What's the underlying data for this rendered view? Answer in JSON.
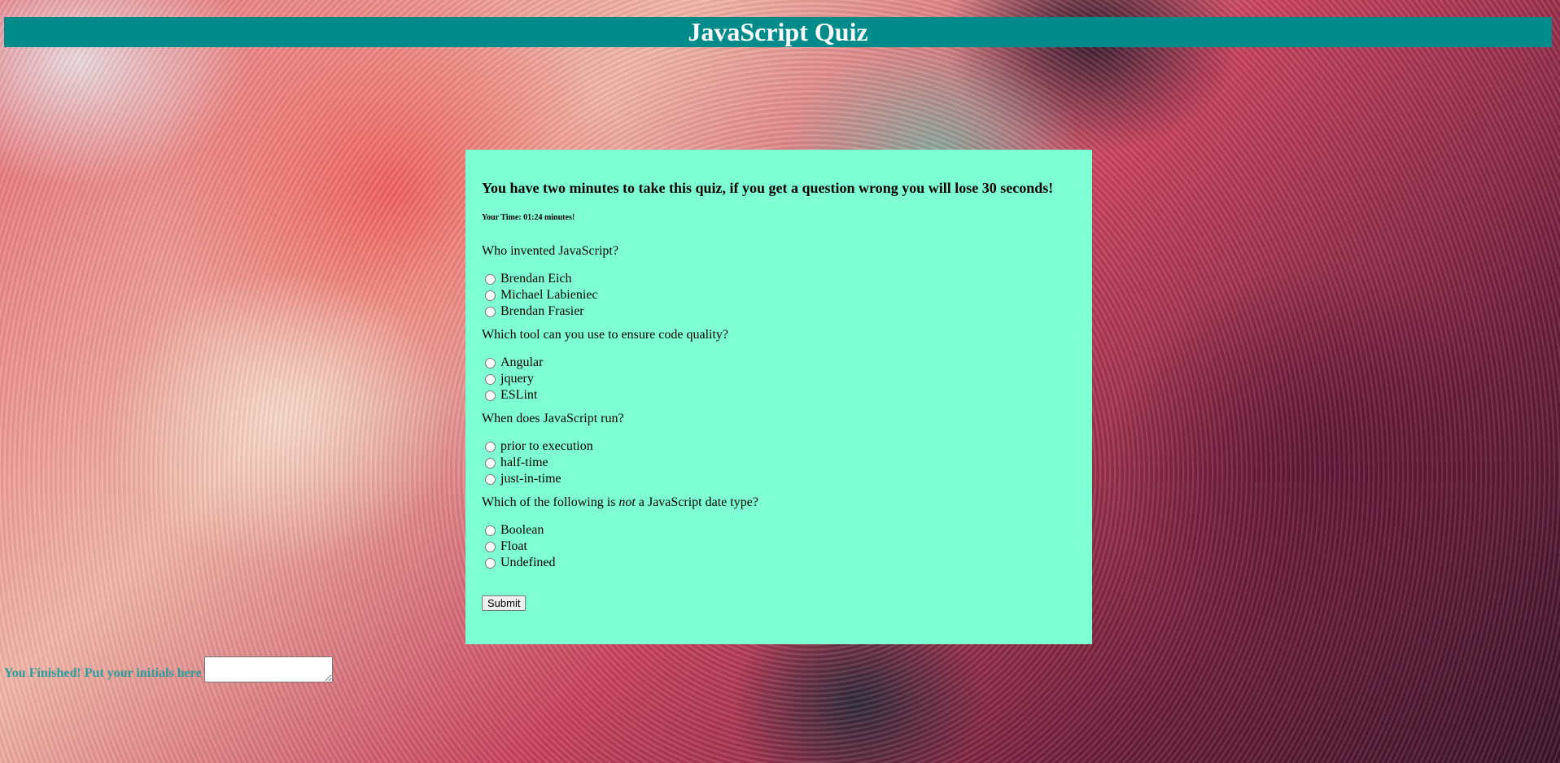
{
  "header": {
    "title": "JavaScript Quiz"
  },
  "quiz": {
    "intro": "You have two minutes to take this quiz, if you get a question wrong you will lose 30 seconds!",
    "timer_text": "Your Time: 01:24 minutes!",
    "questions": [
      {
        "text": "Who invented JavaScript?",
        "options": [
          "Brendan Eich",
          "Michael Labieniec",
          "Brendan Frasier"
        ]
      },
      {
        "text": "Which tool can you use to ensure code quality?",
        "options": [
          "Angular",
          "jquery",
          "ESLint"
        ]
      },
      {
        "text": "When does JavaScript run?",
        "options": [
          "prior to execution",
          "half-time",
          "just-in-time"
        ]
      },
      {
        "text_before": "Which of the following is ",
        "text_emphasis": "not",
        "text_after": " a JavaScript date type?",
        "options": [
          "Boolean",
          "Float",
          "Undefined"
        ]
      }
    ],
    "submit_label": "Submit"
  },
  "finish": {
    "label": "You Finished! Put your initials here",
    "input_value": ""
  },
  "colors": {
    "title_bar": "#008b8b",
    "panel": "#7fffd4",
    "finish_label": "#2a9d9d"
  }
}
